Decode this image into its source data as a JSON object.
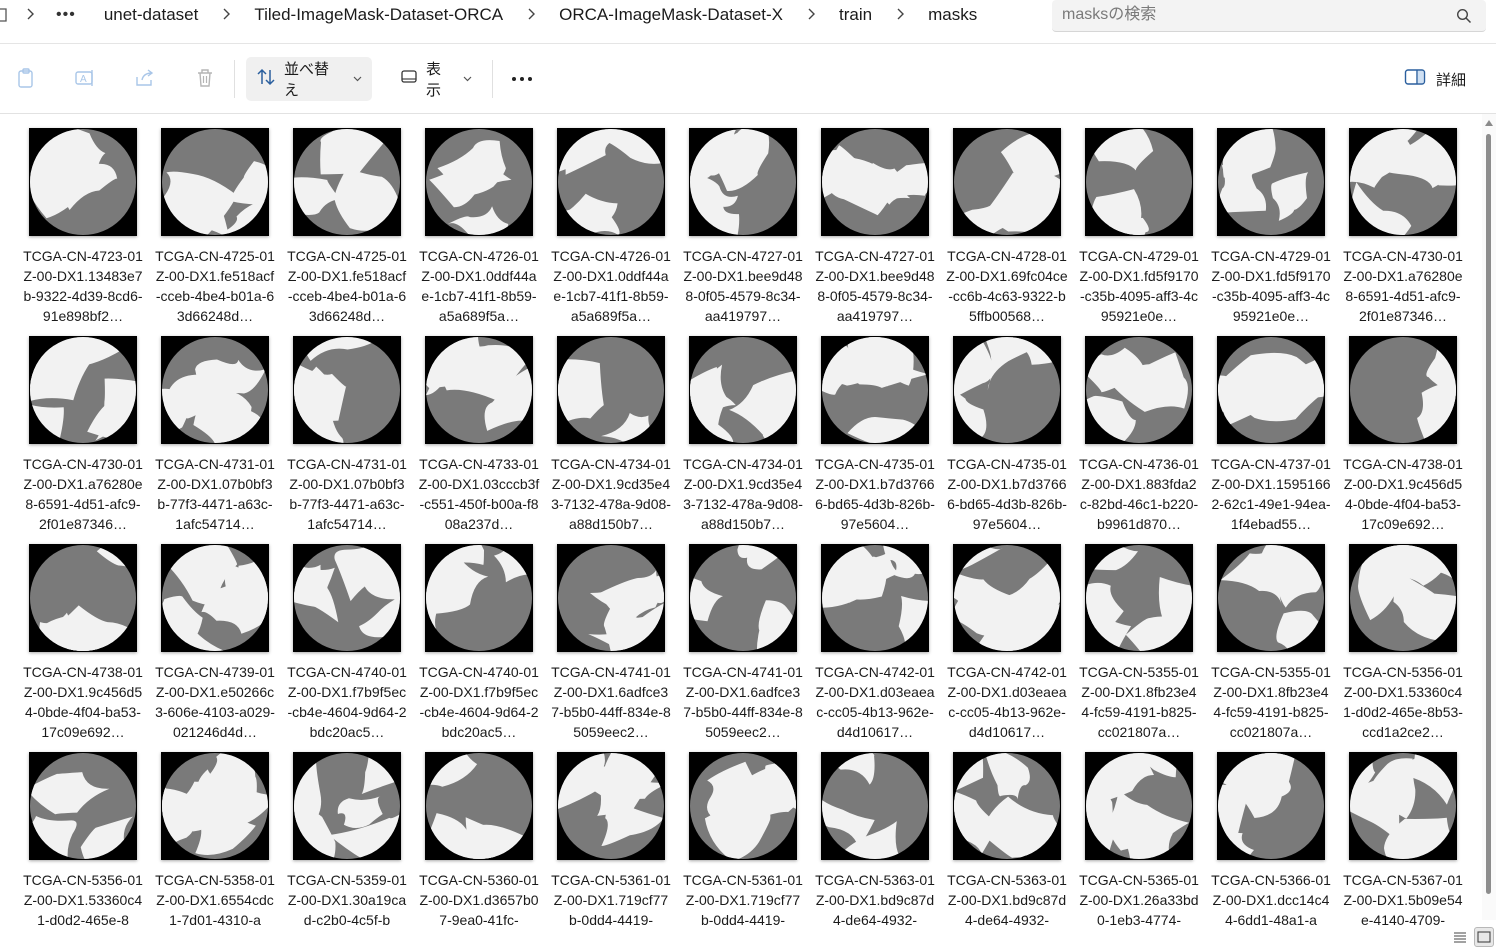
{
  "breadcrumb": {
    "items": [
      "unet-dataset",
      "Tiled-ImageMask-Dataset-ORCA",
      "ORCA-ImageMask-Dataset-X",
      "train",
      "masks"
    ]
  },
  "search": {
    "placeholder": "masksの検索"
  },
  "toolbar": {
    "sort_label": "並べ替え",
    "view_label": "表示",
    "details_label": "詳細"
  },
  "files": [
    "TCGA-CN-4723-01Z-00-DX1.13483e7b-9322-4d39-8cd6-91e898bf2…",
    "TCGA-CN-4725-01Z-00-DX1.fe518acf-cceb-4be4-b01a-63d66248d…",
    "TCGA-CN-4725-01Z-00-DX1.fe518acf-cceb-4be4-b01a-63d66248d…",
    "TCGA-CN-4726-01Z-00-DX1.0ddf44ae-1cb7-41f1-8b59-a5a689f5a…",
    "TCGA-CN-4726-01Z-00-DX1.0ddf44ae-1cb7-41f1-8b59-a5a689f5a…",
    "TCGA-CN-4727-01Z-00-DX1.bee9d488-0f05-4579-8c34-aa419797…",
    "TCGA-CN-4727-01Z-00-DX1.bee9d488-0f05-4579-8c34-aa419797…",
    "TCGA-CN-4728-01Z-00-DX1.69fc04ce-cc6b-4c63-9322-b5ffb00568…",
    "TCGA-CN-4729-01Z-00-DX1.fd5f9170-c35b-4095-aff3-4c95921e0e…",
    "TCGA-CN-4729-01Z-00-DX1.fd5f9170-c35b-4095-aff3-4c95921e0e…",
    "TCGA-CN-4730-01Z-00-DX1.a76280e8-6591-4d51-afc9-2f01e87346…",
    "TCGA-CN-4730-01Z-00-DX1.a76280e8-6591-4d51-afc9-2f01e87346…",
    "TCGA-CN-4731-01Z-00-DX1.07b0bf3b-77f3-4471-a63c-1afc54714…",
    "TCGA-CN-4731-01Z-00-DX1.07b0bf3b-77f3-4471-a63c-1afc54714…",
    "TCGA-CN-4733-01Z-00-DX1.03cccb3f-c551-450f-b00a-f808a237d…",
    "TCGA-CN-4734-01Z-00-DX1.9cd35e43-7132-478a-9d08-a88d150b7…",
    "TCGA-CN-4734-01Z-00-DX1.9cd35e43-7132-478a-9d08-a88d150b7…",
    "TCGA-CN-4735-01Z-00-DX1.b7d37666-bd65-4d3b-826b-97e5604…",
    "TCGA-CN-4735-01Z-00-DX1.b7d37666-bd65-4d3b-826b-97e5604…",
    "TCGA-CN-4736-01Z-00-DX1.883fda2c-82bd-46c1-b220-b9961d870…",
    "TCGA-CN-4737-01Z-00-DX1.15951662-62c1-49e1-94ea-1f4ebad55…",
    "TCGA-CN-4738-01Z-00-DX1.9c456d54-0bde-4f04-ba53-17c09e692…",
    "TCGA-CN-4738-01Z-00-DX1.9c456d54-0bde-4f04-ba53-17c09e692…",
    "TCGA-CN-4739-01Z-00-DX1.e50266c3-606e-4103-a029-021246d4d…",
    "TCGA-CN-4740-01Z-00-DX1.f7b9f5ec-cb4e-4604-9d64-2bdc20ac5…",
    "TCGA-CN-4740-01Z-00-DX1.f7b9f5ec-cb4e-4604-9d64-2bdc20ac5…",
    "TCGA-CN-4741-01Z-00-DX1.6adfce37-b5b0-44ff-834e-85059eec2…",
    "TCGA-CN-4741-01Z-00-DX1.6adfce37-b5b0-44ff-834e-85059eec2…",
    "TCGA-CN-4742-01Z-00-DX1.d03eaeac-cc05-4b13-962e-d4d10617…",
    "TCGA-CN-4742-01Z-00-DX1.d03eaeac-cc05-4b13-962e-d4d10617…",
    "TCGA-CN-5355-01Z-00-DX1.8fb23e44-fc59-4191-b825-cc021807a…",
    "TCGA-CN-5355-01Z-00-DX1.8fb23e44-fc59-4191-b825-cc021807a…",
    "TCGA-CN-5356-01Z-00-DX1.53360c41-d0d2-465e-8b53-ccd1a2ce2…",
    "TCGA-CN-5356-01Z-00-DX1.53360c41-d0d2-465e-8",
    "TCGA-CN-5358-01Z-00-DX1.6554cdc1-7d01-4310-a",
    "TCGA-CN-5359-01Z-00-DX1.30a19cad-c2b0-4c5f-b",
    "TCGA-CN-5360-01Z-00-DX1.d3657b07-9ea0-41fc-",
    "TCGA-CN-5361-01Z-00-DX1.719cf77b-0dd4-4419-",
    "TCGA-CN-5361-01Z-00-DX1.719cf77b-0dd4-4419-",
    "TCGA-CN-5363-01Z-00-DX1.bd9c87d4-de64-4932-",
    "TCGA-CN-5363-01Z-00-DX1.bd9c87d4-de64-4932-",
    "TCGA-CN-5365-01Z-00-DX1.26a33bd0-1eb3-4774-",
    "TCGA-CN-5366-01Z-00-DX1.dcc14c44-6dd1-48a1-a",
    "TCGA-CN-5367-01Z-00-DX1.5b09e54e-4140-4709-"
  ],
  "colors": {
    "mask_background": "#000000",
    "mask_tissue_gray": "#7a7a7a",
    "mask_region_white": "#f2f2f2",
    "sort_button_bg": "#f0f0f0"
  }
}
